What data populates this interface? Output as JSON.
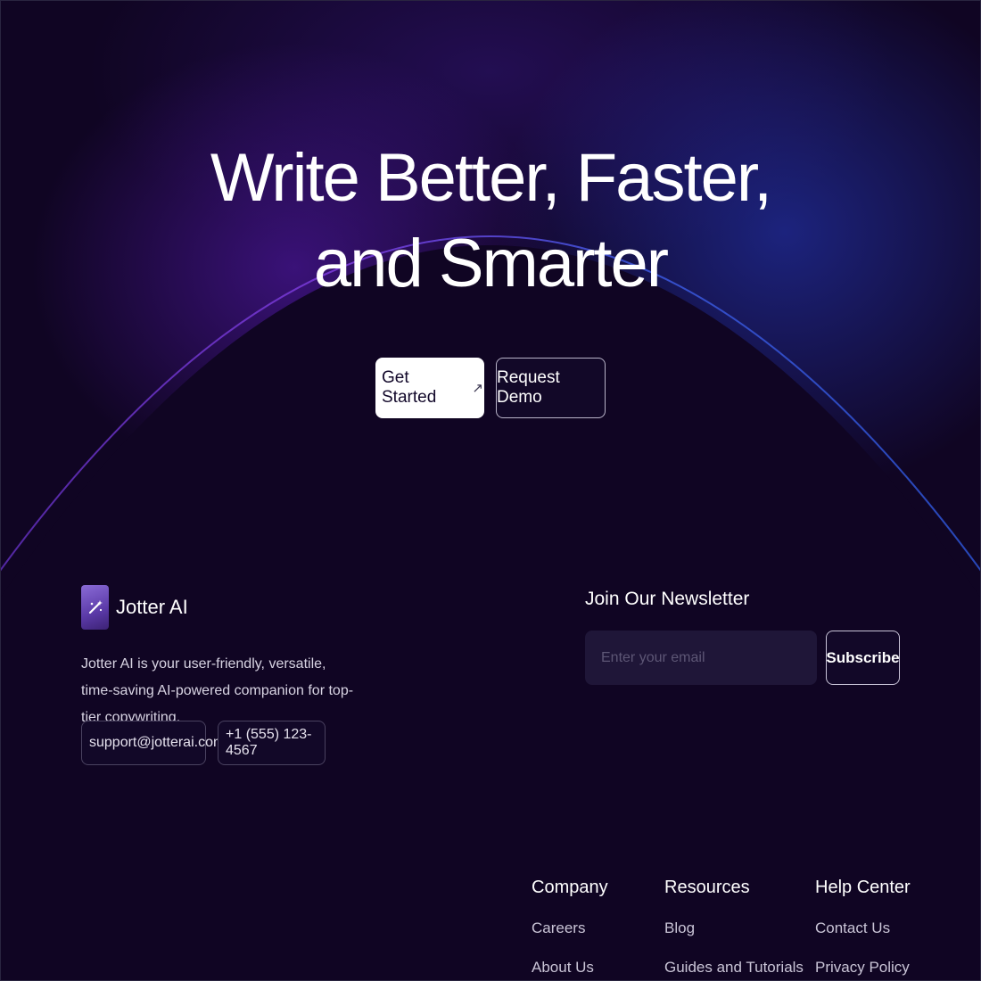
{
  "hero": {
    "title_line1": "Write Better, Faster,",
    "title_line2": "and Smarter",
    "primary_button": "Get Started",
    "primary_button_icon": "arrow-up-right-icon",
    "secondary_button": "Request Demo"
  },
  "brand": {
    "logo_icon": "magic-wand-icon",
    "name": "Jotter AI",
    "description": "Jotter AI is your user-friendly, versatile, time-saving AI-powered companion for top-tier copywriting.",
    "email": "support@jotterai.com",
    "phone": "+1 (555) 123-4567"
  },
  "newsletter": {
    "title": "Join Our Newsletter",
    "placeholder": "Enter your email",
    "button": "Subscribe"
  },
  "footer_columns": [
    {
      "heading": "Company",
      "links": [
        "Careers",
        "About Us"
      ]
    },
    {
      "heading": "Resources",
      "links": [
        "Blog",
        "Guides and Tutorials"
      ]
    },
    {
      "heading": "Help Center",
      "links": [
        "Contact Us",
        "Privacy Policy"
      ]
    }
  ],
  "colors": {
    "background": "#100523",
    "accent_purple": "#5c1cbe",
    "accent_blue": "#263cc8"
  }
}
